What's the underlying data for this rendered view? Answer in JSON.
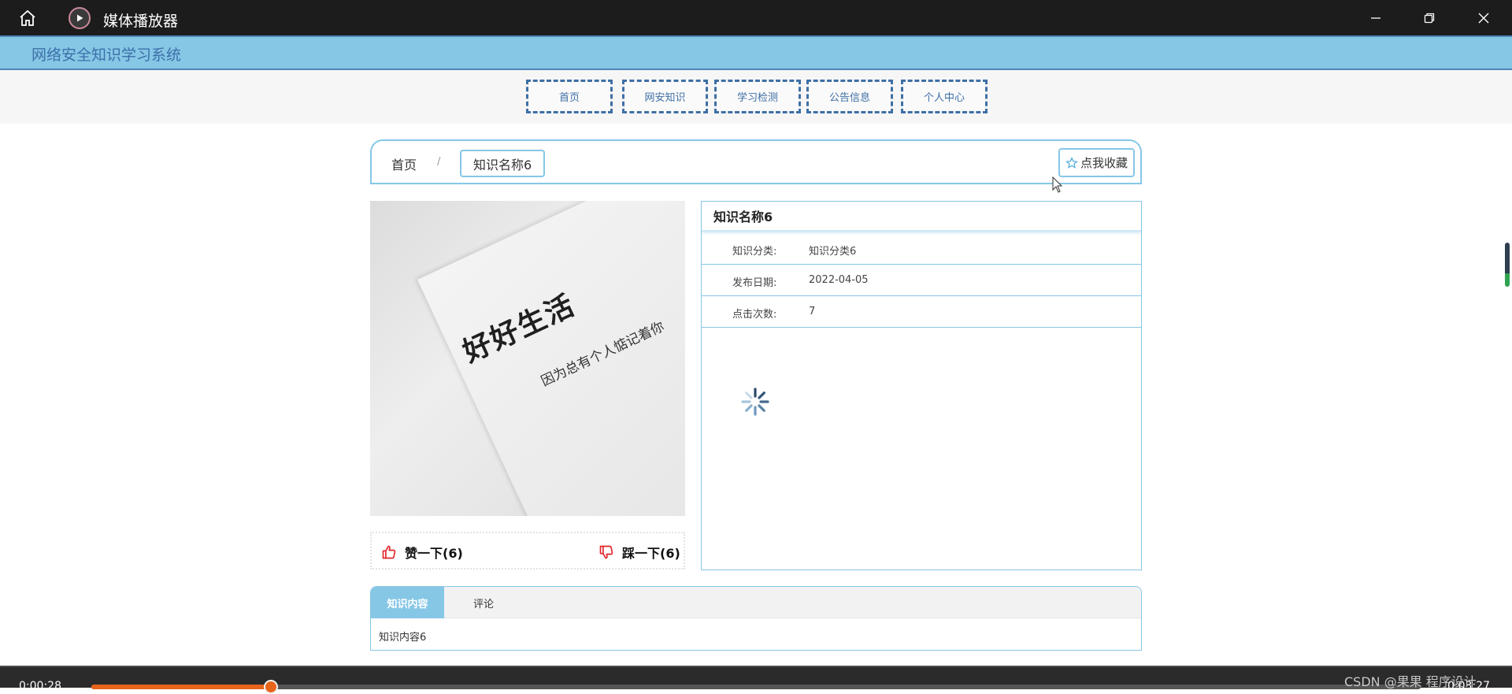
{
  "window": {
    "title": "媒体播放器",
    "home_icon": "home-icon",
    "app_icon": "play-circle-icon",
    "controls": [
      "minimize-icon",
      "restore-icon",
      "close-icon"
    ]
  },
  "site": {
    "title": "网络安全知识学习系统"
  },
  "nav": {
    "items": [
      {
        "label": "首页"
      },
      {
        "label": "网安知识"
      },
      {
        "label": "学习检测"
      },
      {
        "label": "公告信息"
      },
      {
        "label": "个人中心"
      }
    ]
  },
  "breadcrumb": {
    "home": "首页",
    "separator": "/",
    "current": "知识名称6",
    "favorite_label": "点我收藏",
    "favorite_icon": "star-icon"
  },
  "image": {
    "headline": "好好生活",
    "subline": "因为总有个人惦记着你"
  },
  "votes": {
    "like_label": "赞一下(6)",
    "dislike_label": "踩一下(6)",
    "like_icon": "thumbs-up-icon",
    "dislike_icon": "thumbs-down-icon",
    "accent": "#e0262b"
  },
  "detail": {
    "title": "知识名称6",
    "rows": [
      {
        "label": "知识分类:",
        "value": "知识分类6"
      },
      {
        "label": "发布日期:",
        "value": "2022-04-05"
      },
      {
        "label": "点击次数:",
        "value": "7"
      }
    ],
    "loading_icon": "spinner-icon"
  },
  "tabs": {
    "active": "知识内容",
    "other": "评论",
    "content": "知识内容6"
  },
  "player": {
    "current_time": "0:00:28",
    "total_time": "0:03:27",
    "progress": 0.135,
    "accent": "#e8641b",
    "watermark": "CSDN @果果 程序设计"
  },
  "colors": {
    "theme": "#86c7e6",
    "nav_border": "#3f6fa5"
  }
}
